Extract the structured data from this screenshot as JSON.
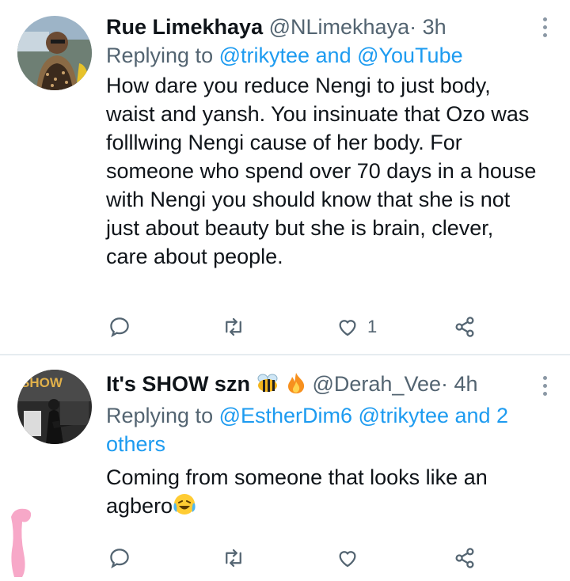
{
  "tweet1": {
    "name": "Rue Limekhaya",
    "handle": "@NLimekhaya",
    "time": "· 3h",
    "reply_prefix": "Replying to",
    "reply_to": "@trikytee and @YouTube",
    "text": "How dare you reduce Nengi to just body, waist and yansh. You insinuate that Ozo was folllwing Nengi cause of her body. For someone who spend over 70 days in a house with Nengi you should know that she is not just about beauty but she is brain, clever, care about people.",
    "likes": "1"
  },
  "tweet2": {
    "name": "It's SHOW szn",
    "handle": "@Derah_Vee",
    "time": "· 4h",
    "reply_prefix": "Replying to",
    "reply_to": "@EstherDim6 @trikytee and 2 others",
    "text": "Coming from someone that looks like an agbero",
    "avatar_text": "SHOW"
  },
  "icons": [
    "reply-icon",
    "retweet-icon",
    "like-icon",
    "share-icon",
    "more-icon",
    "bee-emoji",
    "fire-emoji",
    "laughing-emoji"
  ],
  "colors": {
    "link": "#1d9bf0",
    "muted": "#536471",
    "text": "#0f1419"
  }
}
